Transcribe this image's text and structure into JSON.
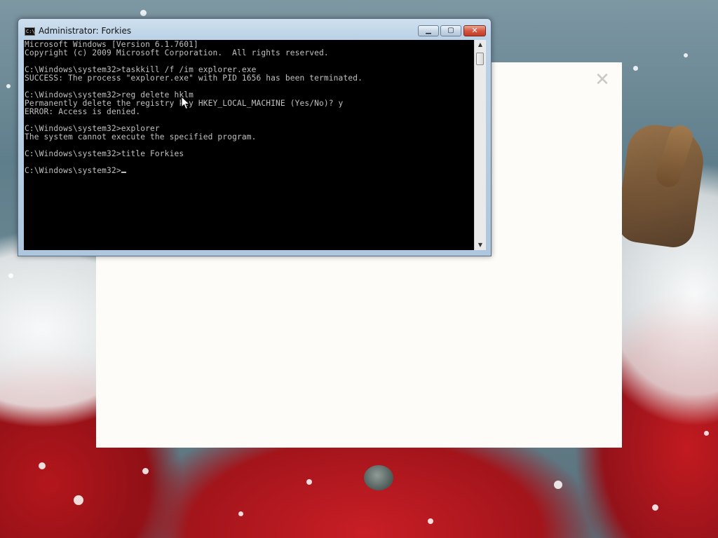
{
  "window": {
    "title": "Administrator: Forkies",
    "icon_text": "C:\\",
    "minimize_label": "▁",
    "maximize_label": "▢",
    "close_label": "✕"
  },
  "console": {
    "lines": [
      "Microsoft Windows [Version 6.1.7601]",
      "Copyright (c) 2009 Microsoft Corporation.  All rights reserved.",
      "",
      "C:\\Windows\\system32>taskkill /f /im explorer.exe",
      "SUCCESS: The process \"explorer.exe\" with PID 1656 has been terminated.",
      "",
      "C:\\Windows\\system32>reg delete hklm",
      "Permanently delete the registry key HKEY_LOCAL_MACHINE (Yes/No)? y",
      "ERROR: Access is denied.",
      "",
      "C:\\Windows\\system32>explorer",
      "The system cannot execute the specified program.",
      "",
      "C:\\Windows\\system32>title Forkies",
      ""
    ],
    "prompt": "C:\\Windows\\system32>"
  },
  "background_pane": {
    "close_label": "✕"
  },
  "icons": {
    "window_icon": "cmd-icon",
    "pointer": "mouse-pointer-icon",
    "scroll_up": "chevron-up-icon",
    "scroll_down": "chevron-down-icon"
  },
  "colors": {
    "console_bg": "#000000",
    "console_fg": "#c0c0c0",
    "close_red": "#c23b24"
  }
}
